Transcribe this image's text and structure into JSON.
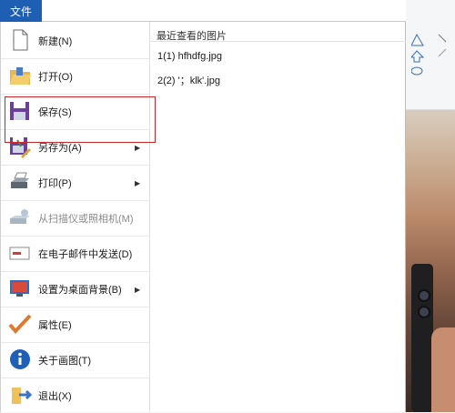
{
  "file_tab": "文件",
  "menu_items": [
    {
      "label": "新建(N)",
      "icon": "new-file-icon",
      "arrow": false,
      "disabled": false
    },
    {
      "label": "打开(O)",
      "icon": "open-folder-icon",
      "arrow": false,
      "disabled": false
    },
    {
      "label": "保存(S)",
      "icon": "save-icon",
      "arrow": false,
      "disabled": false
    },
    {
      "label": "另存为(A)",
      "icon": "save-as-icon",
      "arrow": true,
      "disabled": false
    },
    {
      "label": "打印(P)",
      "icon": "printer-icon",
      "arrow": true,
      "disabled": false
    },
    {
      "label": "从扫描仪或照相机(M)",
      "icon": "scanner-icon",
      "arrow": false,
      "disabled": true
    },
    {
      "label": "在电子邮件中发送(D)",
      "icon": "email-icon",
      "arrow": false,
      "disabled": false
    },
    {
      "label": "设置为桌面背景(B)",
      "icon": "desktop-background-icon",
      "arrow": true,
      "disabled": false
    },
    {
      "label": "属性(E)",
      "icon": "properties-checkmark-icon",
      "arrow": false,
      "disabled": false
    },
    {
      "label": "关于画图(T)",
      "icon": "info-icon",
      "arrow": false,
      "disabled": false
    },
    {
      "label": "退出(X)",
      "icon": "exit-icon",
      "arrow": false,
      "disabled": false
    }
  ],
  "recent_title": "最近查看的图片",
  "recent_files": [
    "1(1)  hfhdfg.jpg",
    "2(2)  '；klk'.jpg"
  ],
  "colors": {
    "accent": "#1e5fb4",
    "highlight_border": "#cc2727"
  }
}
